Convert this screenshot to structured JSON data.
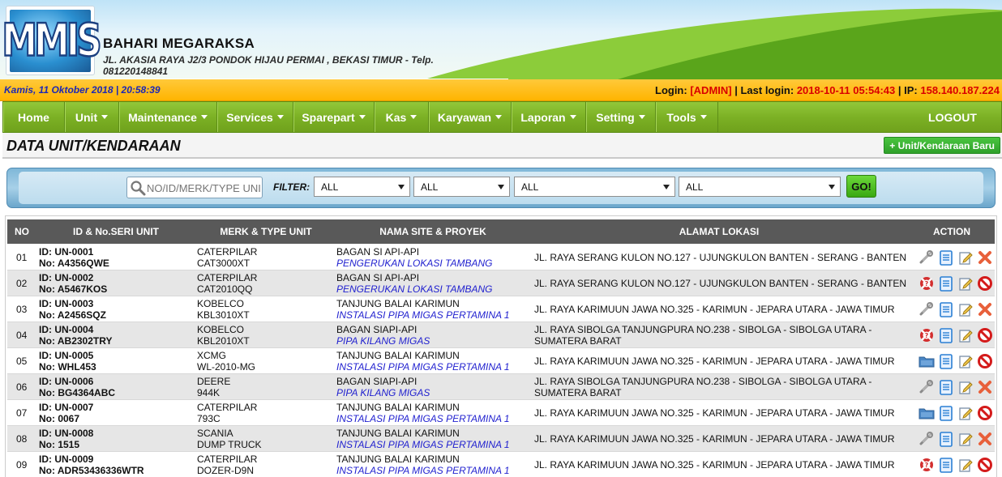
{
  "header": {
    "logo_text": "MMIS",
    "company_name": "BAHARI MEGARAKSA",
    "address_line1": "JL. AKASIA RAYA J2/3 PONDOK HIJAU PERMAI , BEKASI TIMUR - Telp.",
    "address_line2": "081220148841"
  },
  "status": {
    "datetime": "Kamis, 11 Oktober 2018 | 20:58:39",
    "login_label": "Login:",
    "login_user": "[ADMIN]",
    "last_login_label": "| Last login:",
    "last_login": "2018-10-11 05:54:43",
    "ip_label": "| IP:",
    "ip": "158.140.187.224"
  },
  "nav": {
    "items": [
      {
        "label": "Home",
        "dropdown": false
      },
      {
        "label": "Unit",
        "dropdown": true
      },
      {
        "label": "Maintenance",
        "dropdown": true
      },
      {
        "label": "Services",
        "dropdown": true
      },
      {
        "label": "Sparepart",
        "dropdown": true
      },
      {
        "label": "Kas",
        "dropdown": true
      },
      {
        "label": "Karyawan",
        "dropdown": true
      },
      {
        "label": "Laporan",
        "dropdown": true
      },
      {
        "label": "Setting",
        "dropdown": true
      },
      {
        "label": "Tools",
        "dropdown": true
      }
    ],
    "logout": "LOGOUT"
  },
  "page": {
    "title": "DATA UNIT/KENDARAAN",
    "add_button": "+ Unit/Kendaraan Baru"
  },
  "filter": {
    "search_placeholder": "NO/ID/MERK/TYPE UNIT",
    "label": "FILTER:",
    "selects": [
      "ALL",
      "ALL",
      "ALL",
      "ALL"
    ],
    "go": "GO!"
  },
  "table": {
    "headers": [
      "NO",
      "ID & No.SERI UNIT",
      "MERK & TYPE UNIT",
      "NAMA SITE & PROYEK",
      "ALAMAT LOKASI",
      "ACTION"
    ],
    "rows": [
      {
        "no": "01",
        "id": "ID: UN-0001",
        "seri": "No: A4356QWE",
        "merk": "CATERPILAR",
        "type": "CAT3000XT",
        "site": "BAGAN SI API-API",
        "proyek": "PENGERUKAN LOKASI TAMBANG",
        "alamat": "JL. RAYA SERANG KULON NO.127 - UJUNGKULON BANTEN - SERANG - BANTEN",
        "actions": [
          "tools-icon",
          "document-icon",
          "edit-icon",
          "delete-icon"
        ]
      },
      {
        "no": "02",
        "id": "ID: UN-0002",
        "seri": "No: A5467KOS",
        "merk": "CATERPILAR",
        "type": "CAT2010QQ",
        "site": "BAGAN SI API-API",
        "proyek": "PENGERUKAN LOKASI TAMBANG",
        "alamat": "JL. RAYA SERANG KULON NO.127 - UJUNGKULON BANTEN - SERANG - BANTEN",
        "actions": [
          "lifebuoy-icon",
          "document-icon",
          "edit-icon",
          "forbidden-icon"
        ]
      },
      {
        "no": "03",
        "id": "ID: UN-0003",
        "seri": "No: A2456SQZ",
        "merk": "KOBELCO",
        "type": "KBL3010XT",
        "site": "TANJUNG BALAI KARIMUN",
        "proyek": "INSTALASI PIPA MIGAS PERTAMINA 1",
        "alamat": "JL. RAYA KARIMUUN JAWA NO.325 - KARIMUN - JEPARA UTARA - JAWA TIMUR",
        "actions": [
          "tools-icon",
          "document-icon",
          "edit-icon",
          "delete-icon"
        ]
      },
      {
        "no": "04",
        "id": "ID: UN-0004",
        "seri": "No: AB2302TRY",
        "merk": "KOBELCO",
        "type": "KBL2010XT",
        "site": "BAGAN SIAPI-API",
        "proyek": "PIPA KILANG MIGAS",
        "alamat": "JL. RAYA SIBOLGA TANJUNGPURA NO.238 - SIBOLGA - SIBOLGA UTARA - SUMATERA BARAT",
        "actions": [
          "lifebuoy-icon",
          "document-icon",
          "edit-icon",
          "forbidden-icon"
        ]
      },
      {
        "no": "05",
        "id": "ID: UN-0005",
        "seri": "No: WHL453",
        "merk": "XCMG",
        "type": "WL-2010-MG",
        "site": "TANJUNG BALAI KARIMUN",
        "proyek": "INSTALASI PIPA MIGAS PERTAMINA 1",
        "alamat": "JL. RAYA KARIMUUN JAWA NO.325 - KARIMUN - JEPARA UTARA - JAWA TIMUR",
        "actions": [
          "folder-icon",
          "document-icon",
          "edit-icon",
          "forbidden-icon"
        ]
      },
      {
        "no": "06",
        "id": "ID: UN-0006",
        "seri": "No: BG4364ABC",
        "merk": "DEERE",
        "type": "944K",
        "site": "BAGAN SIAPI-API",
        "proyek": "PIPA KILANG MIGAS",
        "alamat": "JL. RAYA SIBOLGA TANJUNGPURA NO.238 - SIBOLGA - SIBOLGA UTARA - SUMATERA BARAT",
        "actions": [
          "tools-icon",
          "document-icon",
          "edit-icon",
          "delete-icon"
        ]
      },
      {
        "no": "07",
        "id": "ID: UN-0007",
        "seri": "No: 0067",
        "merk": "CATERPILAR",
        "type": "793C",
        "site": "TANJUNG BALAI KARIMUN",
        "proyek": "INSTALASI PIPA MIGAS PERTAMINA 1",
        "alamat": "JL. RAYA KARIMUUN JAWA NO.325 - KARIMUN - JEPARA UTARA - JAWA TIMUR",
        "actions": [
          "folder-icon",
          "document-icon",
          "edit-icon",
          "forbidden-icon"
        ]
      },
      {
        "no": "08",
        "id": "ID: UN-0008",
        "seri": "No: 1515",
        "merk": "SCANIA",
        "type": "DUMP TRUCK",
        "site": "TANJUNG BALAI KARIMUN",
        "proyek": "INSTALASI PIPA MIGAS PERTAMINA 1",
        "alamat": "JL. RAYA KARIMUUN JAWA NO.325 - KARIMUN - JEPARA UTARA - JAWA TIMUR",
        "actions": [
          "tools-icon",
          "document-icon",
          "edit-icon",
          "delete-icon"
        ]
      },
      {
        "no": "09",
        "id": "ID: UN-0009",
        "seri": "No: ADR53436336WTR",
        "merk": "CATERPILAR",
        "type": "DOZER-D9N",
        "site": "TANJUNG BALAI KARIMUN",
        "proyek": "INSTALASI PIPA MIGAS PERTAMINA 1",
        "alamat": "JL. RAYA KARIMUUN JAWA NO.325 - KARIMUN - JEPARA UTARA - JAWA TIMUR",
        "actions": [
          "lifebuoy-icon",
          "document-icon",
          "edit-icon",
          "forbidden-icon"
        ]
      }
    ]
  }
}
